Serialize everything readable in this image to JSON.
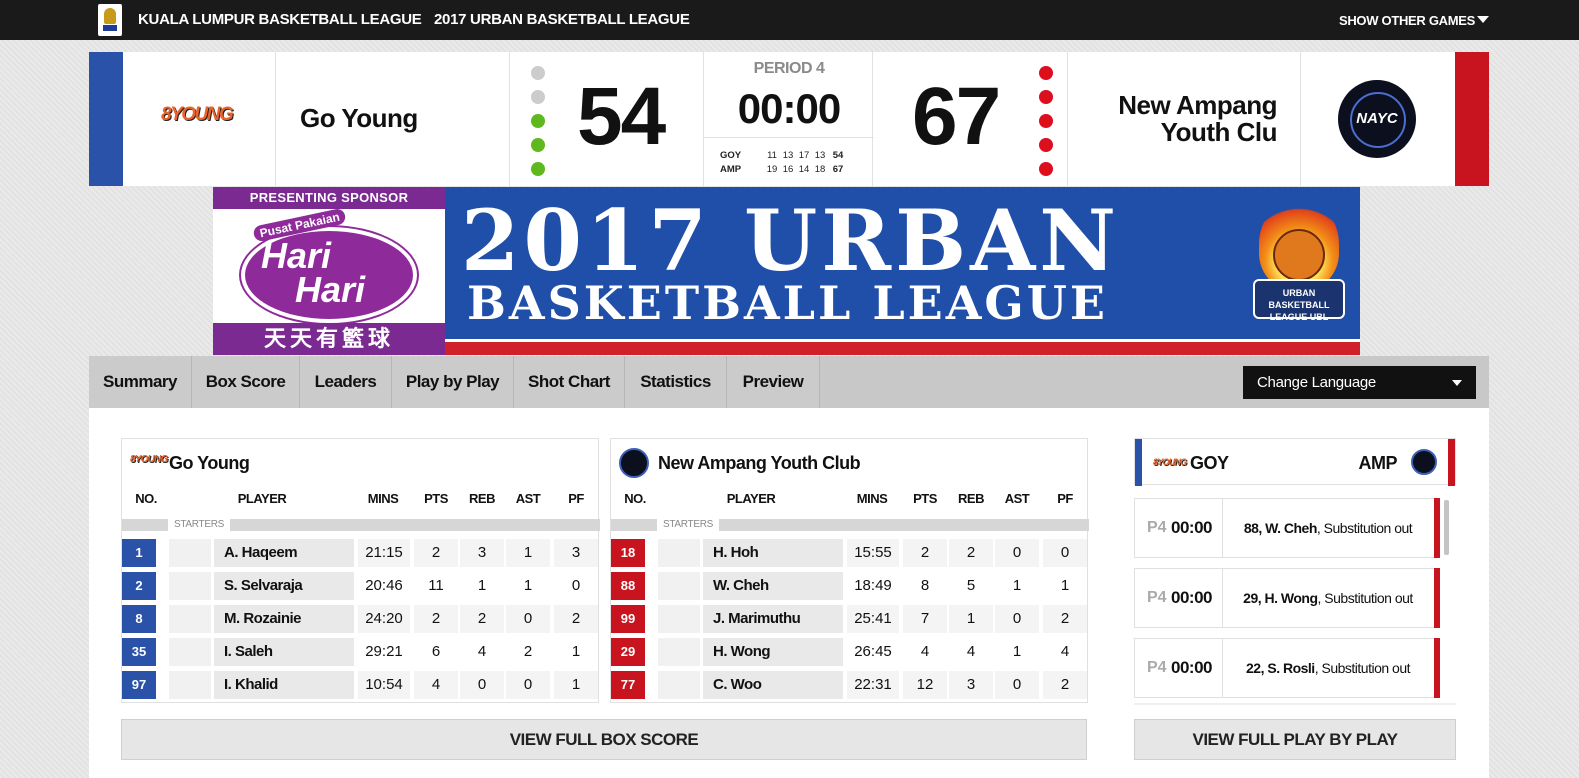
{
  "topbar": {
    "league": "KUALA LUMPUR BASKETBALL LEAGUE",
    "season": "2017 URBAN BASKETBALL LEAGUE",
    "other_games": "SHOW OTHER GAMES"
  },
  "scoreboard": {
    "home": {
      "logo_text": "8YOUNG",
      "name": "Go Young",
      "score": "54",
      "color": "#2952a8",
      "timeouts_used": 2,
      "timeouts_total": 5
    },
    "away": {
      "logo_text": "NAYC",
      "name_line1": "New Ampang",
      "name_line2": "Youth Clu",
      "score": "67",
      "color": "#c8141e",
      "timeouts_used": 0,
      "timeouts_total": 5
    },
    "period": "PERIOD 4",
    "clock": "00:00",
    "quarters": [
      {
        "abbr": "GOY",
        "q": [
          "11",
          "13",
          "17",
          "13"
        ],
        "total": "54"
      },
      {
        "abbr": "AMP",
        "q": [
          "19",
          "16",
          "14",
          "18"
        ],
        "total": "67"
      }
    ]
  },
  "banner": {
    "sponsor_tag": "PRESENTING SPONSOR",
    "pusat": "Pusat Pakaian",
    "hari1": "Hari",
    "hari2": "Hari",
    "cjk": "天天有籃球",
    "title1": "2017 URBAN",
    "title2": "BASKETBALL LEAGUE",
    "badge": "URBAN BASKETBALL LEAGUE UBL"
  },
  "tabs": [
    "Summary",
    "Box Score",
    "Leaders",
    "Play by Play",
    "Shot Chart",
    "Statistics",
    "Preview"
  ],
  "language": {
    "label": "Change Language"
  },
  "boxscore": {
    "columns": [
      "NO.",
      "PLAYER",
      "MINS",
      "PTS",
      "REB",
      "AST",
      "PF"
    ],
    "starters_label": "STARTERS",
    "home": {
      "logo_text": "8YOUNG",
      "name": "Go Young",
      "players": [
        {
          "no": "1",
          "name": "A. Haqeem",
          "mins": "21:15",
          "pts": "2",
          "reb": "3",
          "ast": "1",
          "pf": "3"
        },
        {
          "no": "2",
          "name": "S. Selvaraja",
          "mins": "20:46",
          "pts": "11",
          "reb": "1",
          "ast": "1",
          "pf": "0"
        },
        {
          "no": "8",
          "name": "M. Rozainie",
          "mins": "24:20",
          "pts": "2",
          "reb": "2",
          "ast": "0",
          "pf": "2"
        },
        {
          "no": "35",
          "name": "I. Saleh",
          "mins": "29:21",
          "pts": "6",
          "reb": "4",
          "ast": "2",
          "pf": "1"
        },
        {
          "no": "97",
          "name": "I. Khalid",
          "mins": "10:54",
          "pts": "4",
          "reb": "0",
          "ast": "0",
          "pf": "1"
        }
      ]
    },
    "away": {
      "name": "New Ampang Youth Club",
      "players": [
        {
          "no": "18",
          "name": "H. Hoh",
          "mins": "15:55",
          "pts": "2",
          "reb": "2",
          "ast": "0",
          "pf": "0"
        },
        {
          "no": "88",
          "name": "W. Cheh",
          "mins": "18:49",
          "pts": "8",
          "reb": "5",
          "ast": "1",
          "pf": "1"
        },
        {
          "no": "99",
          "name": "J. Marimuthu",
          "mins": "25:41",
          "pts": "7",
          "reb": "1",
          "ast": "0",
          "pf": "2"
        },
        {
          "no": "29",
          "name": "H. Wong",
          "mins": "26:45",
          "pts": "4",
          "reb": "4",
          "ast": "1",
          "pf": "4"
        },
        {
          "no": "77",
          "name": "C. Woo",
          "mins": "22:31",
          "pts": "12",
          "reb": "3",
          "ast": "0",
          "pf": "2"
        }
      ]
    },
    "view_full": "VIEW FULL BOX SCORE"
  },
  "playbyplay": {
    "home_abbr": "GOY",
    "away_abbr": "AMP",
    "events": [
      {
        "period": "P4",
        "time": "00:00",
        "player": "88, W. Cheh",
        "action": ", Substitution out"
      },
      {
        "period": "P4",
        "time": "00:00",
        "player": "29, H. Wong",
        "action": ", Substitution out"
      },
      {
        "period": "P4",
        "time": "00:00",
        "player": "22, S. Rosli",
        "action": ", Substitution out"
      }
    ],
    "view_full": "VIEW FULL PLAY BY PLAY"
  }
}
